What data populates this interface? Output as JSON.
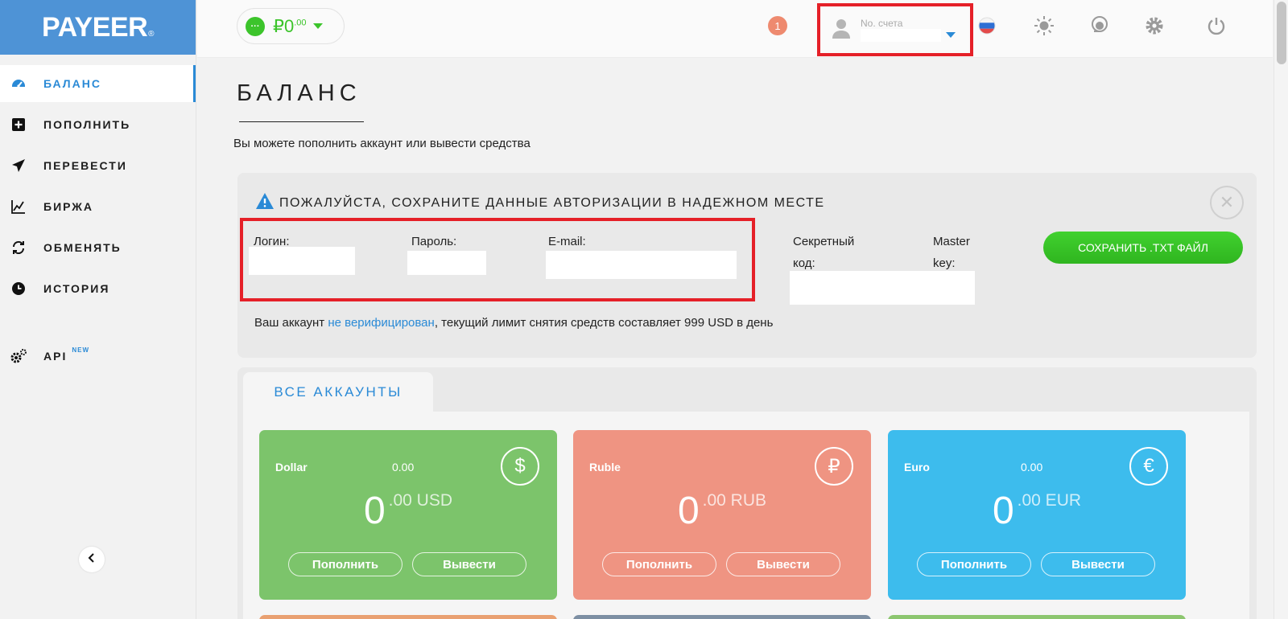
{
  "sidebar": {
    "logo": "PAYEER",
    "logo_mark": "®",
    "items": [
      {
        "label": "БАЛАНС",
        "icon": "dashboard-icon",
        "active": true
      },
      {
        "label": "ПОПОЛНИТЬ",
        "icon": "plus-square-icon"
      },
      {
        "label": "ПЕРЕВЕСТИ",
        "icon": "paper-plane-icon"
      },
      {
        "label": "БИРЖА",
        "icon": "chart-line-icon"
      },
      {
        "label": "ОБМЕНЯТЬ",
        "icon": "exchange-arrows-icon"
      },
      {
        "label": "ИСТОРИЯ",
        "icon": "clock-icon"
      }
    ],
    "api": {
      "label": "API",
      "badge": "NEW",
      "icon": "gears-icon"
    }
  },
  "topbar": {
    "balance_dots": "···",
    "balance_int": "₽0",
    "balance_frac": ".00",
    "notifications": "1",
    "account_label": "No. счета"
  },
  "page": {
    "title": "БАЛАНС",
    "subtitle": "Вы можете пополнить аккаунт или вывести средства"
  },
  "warning": {
    "title": "ПОЖАЛУЙСТА, СОХРАНИТЕ ДАННЫЕ АВТОРИЗАЦИИ В НАДЕЖНОМ МЕСТЕ",
    "close": "✕",
    "login_label": "Логин:",
    "password_label": "Пароль:",
    "email_label": "E-mail:",
    "secret_label_1": "Секретный",
    "secret_label_2": "код:",
    "master_label_1": "Master",
    "master_label_2": "key:",
    "save_button": "СОХРАНИТЬ .TXT ФАЙЛ",
    "verify_prefix": "Ваш аккаунт ",
    "verify_link": "не верифицирован",
    "verify_suffix": ", текущий лимит снятия средств составляет 999 USD в день"
  },
  "accounts": {
    "tab_label": "ВСЕ АККАУНТЫ",
    "cards": [
      {
        "name": "Dollar",
        "small": "0.00",
        "symbol": "$",
        "int": "0",
        "frac": ".00 USD",
        "deposit": "Пополнить",
        "withdraw": "Вывести",
        "color": "#7cc46b"
      },
      {
        "name": "Ruble",
        "small": "",
        "symbol": "₽",
        "int": "0",
        "frac": ".00 RUB",
        "deposit": "Пополнить",
        "withdraw": "Вывести",
        "color": "#ef9482"
      },
      {
        "name": "Euro",
        "small": "0.00",
        "symbol": "€",
        "int": "0",
        "frac": ".00 EUR",
        "deposit": "Пополнить",
        "withdraw": "Вывести",
        "color": "#3dbced"
      }
    ],
    "peek_colors": [
      "#e9a071",
      "#7d8fa3",
      "#8cc66f"
    ]
  }
}
